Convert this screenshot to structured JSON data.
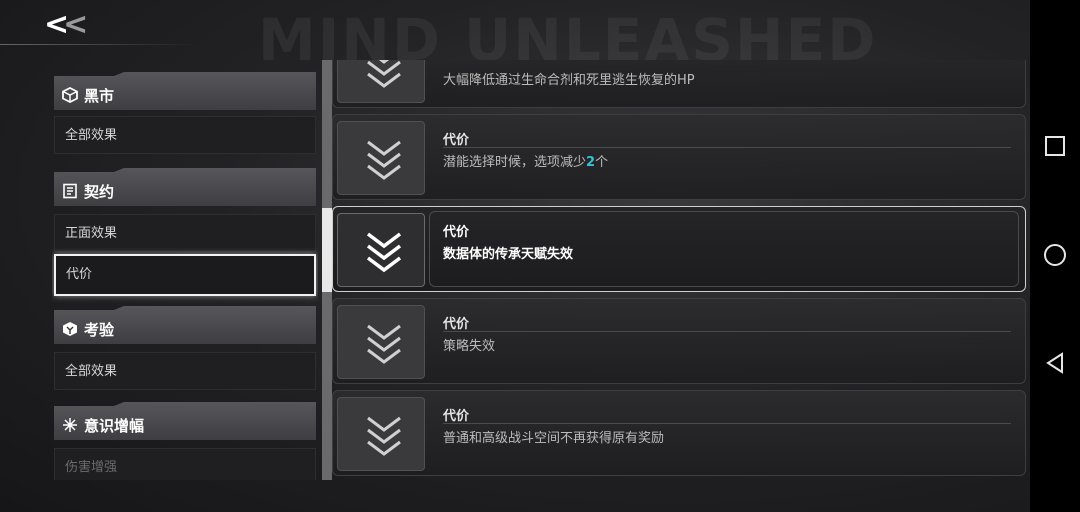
{
  "header": {
    "back_label": "<",
    "back_label_faint": "<",
    "bg_title": "MIND UNLEASHED"
  },
  "sidebar": {
    "categories": [
      {
        "label": "黑市",
        "icon": "cube-icon",
        "item": "全部效果"
      },
      {
        "label": "契约",
        "icon": "contract-icon",
        "items": [
          "正面效果",
          "代价"
        ]
      },
      {
        "label": "考验",
        "icon": "trial-icon",
        "item": "全部效果"
      },
      {
        "label": "意识增幅",
        "icon": "star-burst-icon",
        "item": "伤害增强"
      }
    ],
    "selected": "代价"
  },
  "cards": [
    {
      "title": "",
      "desc": "大幅降低通过生命合剂和死里逃生恢复的HP",
      "active": false
    },
    {
      "title": "代价",
      "desc_prefix": "潜能选择时候，选项减少",
      "desc_num": "2",
      "desc_suffix": "个",
      "active": false
    },
    {
      "title": "代价",
      "desc": "数据体的传承天赋失效",
      "active": true
    },
    {
      "title": "代价",
      "desc": "策略失效",
      "active": false
    },
    {
      "title": "代价",
      "desc": "普通和高级战斗空间不再获得原有奖励",
      "active": false
    }
  ],
  "colors": {
    "highlight": "#34c3d8",
    "accent_border": "#f2f2f2"
  },
  "navbar": {
    "buttons": [
      "recent-apps",
      "home",
      "back"
    ]
  }
}
